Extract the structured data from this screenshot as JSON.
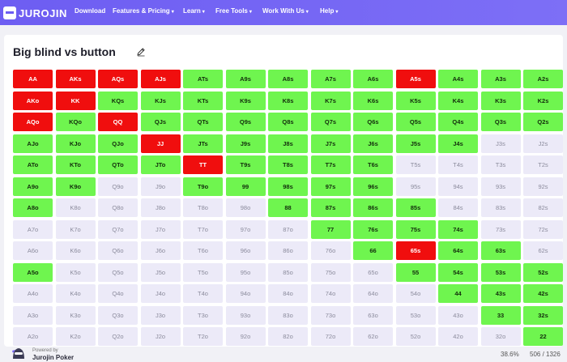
{
  "nav": {
    "logo": "JUROJIN",
    "items": [
      {
        "label": "Download",
        "caret": ""
      },
      {
        "label": "Features & Pricing",
        "caret": "▾"
      },
      {
        "label": "Learn",
        "caret": "▾"
      },
      {
        "label": "Free Tools",
        "caret": "▾"
      },
      {
        "label": "Work With Us",
        "caret": "▾"
      },
      {
        "label": "Help",
        "caret": "▾"
      }
    ]
  },
  "page": {
    "title": "Big blind vs button",
    "edit_icon": "pencil-icon"
  },
  "colors": {
    "green": "#6ff54f",
    "red": "#f00e0e",
    "empty": "#eceaf8",
    "accent": "#6d5df2"
  },
  "grid": {
    "rows": [
      [
        "AA",
        "AKs",
        "AQs",
        "AJs",
        "ATs",
        "A9s",
        "A8s",
        "A7s",
        "A6s",
        "A5s",
        "A4s",
        "A3s",
        "A2s"
      ],
      [
        "AKo",
        "KK",
        "KQs",
        "KJs",
        "KTs",
        "K9s",
        "K8s",
        "K7s",
        "K6s",
        "K5s",
        "K4s",
        "K3s",
        "K2s"
      ],
      [
        "AQo",
        "KQo",
        "QQ",
        "QJs",
        "QTs",
        "Q9s",
        "Q8s",
        "Q7s",
        "Q6s",
        "Q5s",
        "Q4s",
        "Q3s",
        "Q2s"
      ],
      [
        "AJo",
        "KJo",
        "QJo",
        "JJ",
        "JTs",
        "J9s",
        "J8s",
        "J7s",
        "J6s",
        "J5s",
        "J4s",
        "J3s",
        "J2s"
      ],
      [
        "ATo",
        "KTo",
        "QTo",
        "JTo",
        "TT",
        "T9s",
        "T8s",
        "T7s",
        "T6s",
        "T5s",
        "T4s",
        "T3s",
        "T2s"
      ],
      [
        "A9o",
        "K9o",
        "Q9o",
        "J9o",
        "T9o",
        "99",
        "98s",
        "97s",
        "96s",
        "95s",
        "94s",
        "93s",
        "92s"
      ],
      [
        "A8o",
        "K8o",
        "Q8o",
        "J8o",
        "T8o",
        "98o",
        "88",
        "87s",
        "86s",
        "85s",
        "84s",
        "83s",
        "82s"
      ],
      [
        "A7o",
        "K7o",
        "Q7o",
        "J7o",
        "T7o",
        "97o",
        "87o",
        "77",
        "76s",
        "75s",
        "74s",
        "73s",
        "72s"
      ],
      [
        "A6o",
        "K6o",
        "Q6o",
        "J6o",
        "T6o",
        "96o",
        "86o",
        "76o",
        "66",
        "65s",
        "64s",
        "63s",
        "62s"
      ],
      [
        "A5o",
        "K5o",
        "Q5o",
        "J5o",
        "T5o",
        "95o",
        "85o",
        "75o",
        "65o",
        "55",
        "54s",
        "53s",
        "52s"
      ],
      [
        "A4o",
        "K4o",
        "Q4o",
        "J4o",
        "T4o",
        "94o",
        "84o",
        "74o",
        "64o",
        "54o",
        "44",
        "43s",
        "42s"
      ],
      [
        "A3o",
        "K3o",
        "Q3o",
        "J3o",
        "T3o",
        "93o",
        "83o",
        "73o",
        "63o",
        "53o",
        "43o",
        "33",
        "32s"
      ],
      [
        "A2o",
        "K2o",
        "Q2o",
        "J2o",
        "T2o",
        "92o",
        "82o",
        "72o",
        "62o",
        "52o",
        "42o",
        "32o",
        "22"
      ]
    ],
    "states": [
      "RRRRGGGGGRGGG",
      "RRGGGGGGGGGGG",
      "RGRGGGGGGGGGG",
      "GGGRGGGGGGGEE",
      "GGGGRGGGGEEEE",
      "GGEEGGGGGEEEE",
      "GEEEEEGGGGEEE",
      "EEEEEEEGGGGEE",
      "EEEEEEEEGRGGE",
      "GEEEEEEEEGGGG",
      "EEEEEEEEEEGGG",
      "EEEEEEEEEEEGG",
      "EEEEEEEEEEEEG"
    ]
  },
  "footer": {
    "powered_by": "Powered by",
    "brand": "Jurojin Poker",
    "logo_icon": "ninja-icon",
    "percent": "38.6%",
    "combos": "506 / 1326"
  }
}
